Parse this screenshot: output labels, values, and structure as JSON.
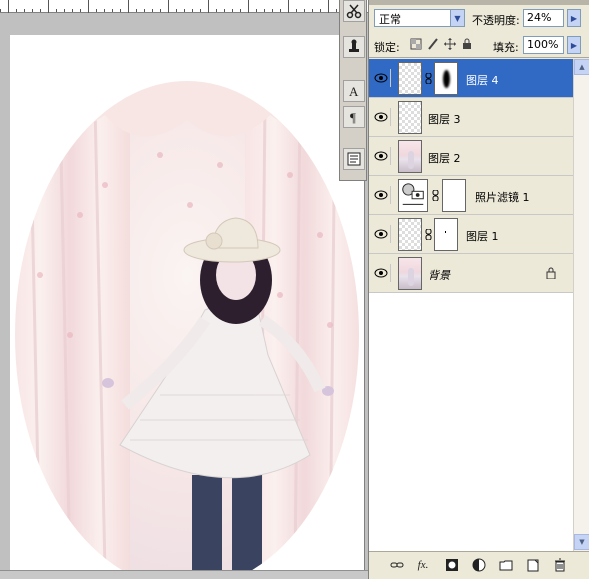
{
  "layers_panel": {
    "blend_mode": "正常",
    "opacity_label": "不透明度:",
    "opacity_value": "24%",
    "lock_label": "锁定:",
    "fill_label": "填充:",
    "fill_value": "100%",
    "layers": [
      {
        "name": "图层 4",
        "selected": true,
        "visible": true
      },
      {
        "name": "图层 3",
        "selected": false,
        "visible": true
      },
      {
        "name": "图层 2",
        "selected": false,
        "visible": true
      },
      {
        "name": "照片滤镜 1",
        "selected": false,
        "visible": true
      },
      {
        "name": "图层 1",
        "selected": false,
        "visible": true
      },
      {
        "name": "背景",
        "selected": false,
        "visible": true,
        "locked": true
      }
    ]
  },
  "tools": [
    "scissors-icon",
    "stamp-icon",
    "type-tool-icon",
    "paragraph-icon",
    "notes-icon"
  ],
  "colors": {
    "selection": "#316ac5",
    "panel_bg": "#ece9d8",
    "workspace_bg": "#c0c0c0"
  }
}
